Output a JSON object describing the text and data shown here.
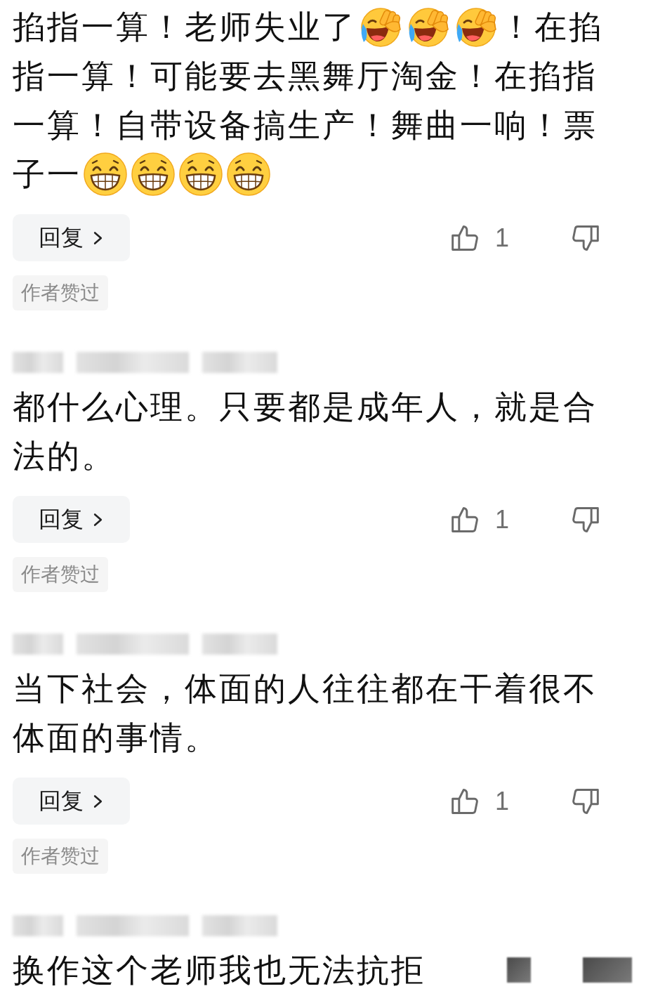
{
  "comments": [
    {
      "segments": [
        {
          "kind": "text",
          "text": "掐指一算！老师失业了"
        },
        {
          "kind": "laugh_cry"
        },
        {
          "kind": "laugh_cry"
        },
        {
          "kind": "laugh_cry"
        },
        {
          "kind": "text",
          "text": "！在掐"
        },
        {
          "kind": "text",
          "text": "指一算！可能要去黑舞厅淘金！在掐指"
        },
        {
          "kind": "text",
          "text": "一算！自带设备搞生产！舞曲一响！票"
        },
        {
          "kind": "text",
          "text": "子一"
        },
        {
          "kind": "grin"
        },
        {
          "kind": "grin"
        },
        {
          "kind": "grin"
        },
        {
          "kind": "grin"
        }
      ],
      "reply": "回复",
      "likes": "1",
      "badge": "作者赞过"
    },
    {
      "author": {
        "kind": "blurred"
      },
      "segments": [
        {
          "kind": "text",
          "text": "都什么心理。只要都是成年人，就是合法的。"
        }
      ],
      "reply": "回复",
      "likes": "1",
      "badge": "作者赞过"
    },
    {
      "author": {
        "kind": "blurred"
      },
      "segments": [
        {
          "kind": "text",
          "text": "当下社会，体面的人往往都在干着很不体面的事情。"
        }
      ],
      "reply": "回复",
      "likes": "1",
      "badge": "作者赞过"
    },
    {
      "author": {
        "kind": "blurred"
      },
      "segments": [
        {
          "kind": "text",
          "text": "换作这个老师我也无法抗拒"
        }
      ],
      "obscured": {
        "kind": "blurred"
      }
    }
  ]
}
